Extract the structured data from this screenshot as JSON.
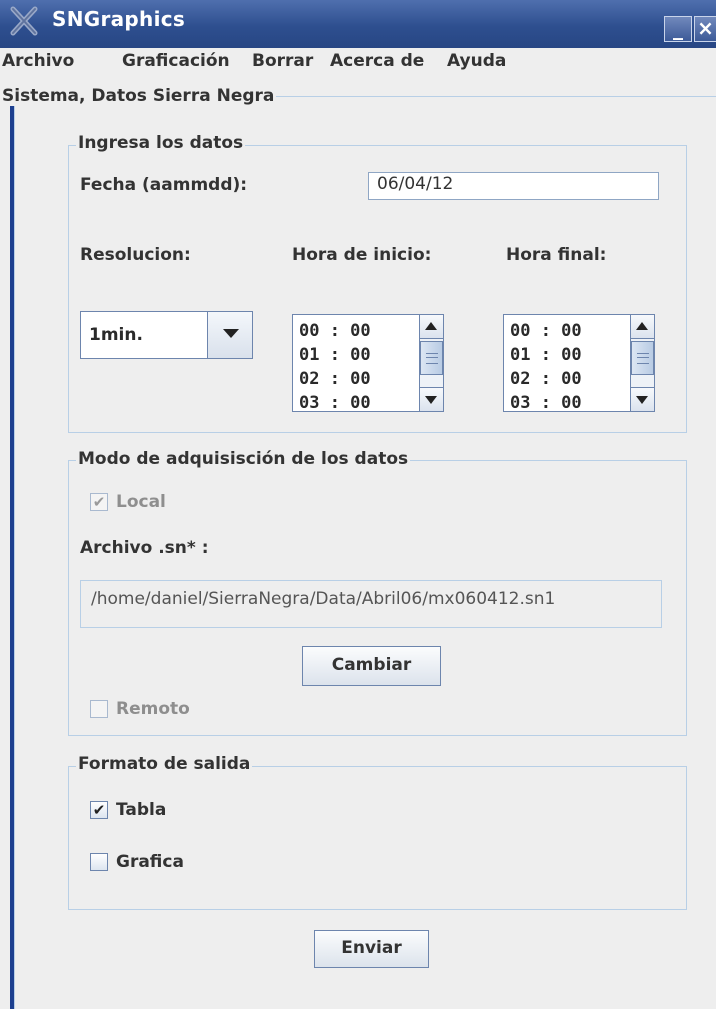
{
  "window": {
    "title": "SNGraphics",
    "minimize_glyph": "_",
    "close_glyph": "×"
  },
  "menu": [
    "Archivo",
    "Graficación",
    "Borrar",
    "Acerca de",
    "Ayuda"
  ],
  "panel": {
    "title": "Sistema, Datos Sierra Negra"
  },
  "ingresa": {
    "legend": "Ingresa los datos",
    "fecha_label": "Fecha (aammdd):",
    "fecha_value": "06/04/12",
    "resolucion_label": "Resolucion:",
    "resolucion_value": "1min.",
    "hora_inicio_label": "Hora de inicio:",
    "hora_final_label": "Hora final:",
    "horas": [
      "00 : 00",
      "01 : 00",
      "02 : 00",
      "03 : 00"
    ]
  },
  "modo": {
    "legend": "Modo de adquisisción de los datos",
    "local_label": "Local",
    "local_checked": true,
    "archivo_label": "Archivo .sn* :",
    "archivo_path": "/home/daniel/SierraNegra/Data/Abril06/mx060412.sn1",
    "cambiar_label": "Cambiar",
    "remoto_label": "Remoto",
    "remoto_checked": false
  },
  "formato": {
    "legend": "Formato de salida",
    "tabla_label": "Tabla",
    "tabla_checked": true,
    "grafica_label": "Grafica",
    "grafica_checked": false
  },
  "enviar_label": "Enviar",
  "icons": {
    "app": "x-logo-icon",
    "check": "✔"
  },
  "colors": {
    "titlebar": "#2e4f8f",
    "border": "#b8cfe6",
    "control_border": "#6d85ad"
  }
}
